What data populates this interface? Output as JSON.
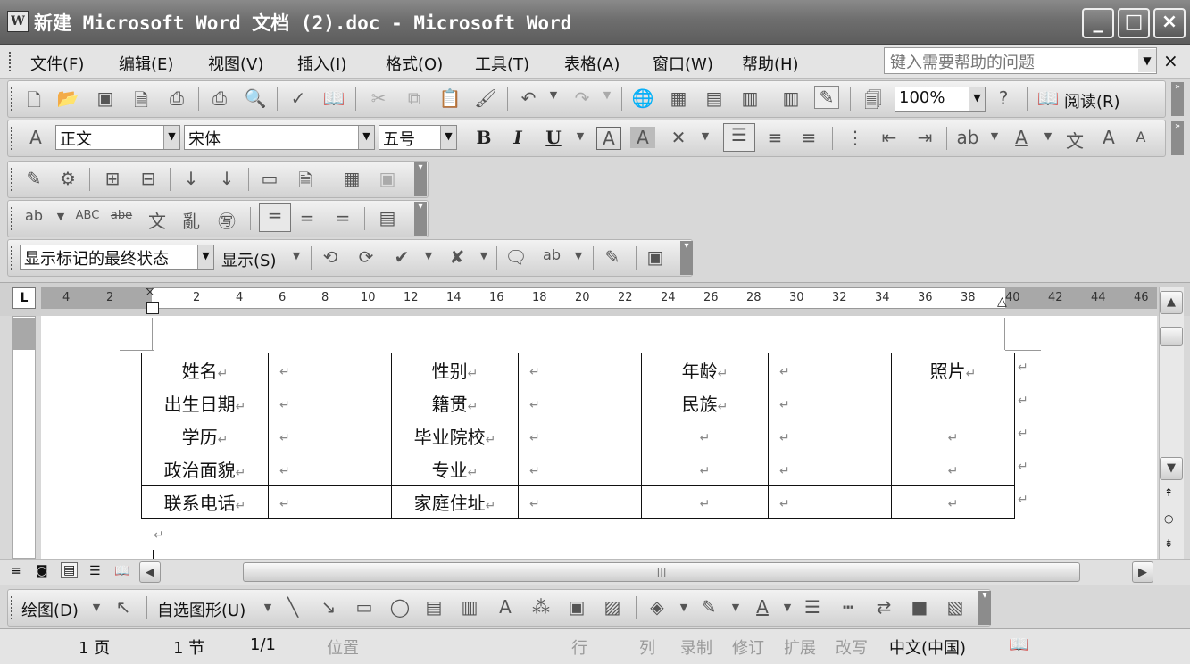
{
  "window": {
    "title": "新建 Microsoft Word 文档 (2).doc - Microsoft Word",
    "app_icon": "W",
    "minimize": "_",
    "maximize": "□",
    "close": "×"
  },
  "menubar": {
    "items": [
      "文件(F)",
      "编辑(E)",
      "视图(V)",
      "插入(I)",
      "格式(O)",
      "工具(T)",
      "表格(A)",
      "窗口(W)",
      "帮助(H)"
    ],
    "help_placeholder": "键入需要帮助的问题",
    "doc_close": "×"
  },
  "standard_toolbar": {
    "zoom": "100%",
    "reading_label": "阅读(R)"
  },
  "formatting_toolbar": {
    "style": "正文",
    "font": "宋体",
    "size": "五号",
    "bold": "B",
    "italic": "I",
    "underline": "U"
  },
  "reviewing_toolbar": {
    "display_state": "显示标记的最终状态",
    "show_label": "显示(S)"
  },
  "ruler": {
    "tab_selector": "L",
    "numbers": [
      "4",
      "2",
      "2",
      "4",
      "6",
      "8",
      "10",
      "12",
      "14",
      "16",
      "18",
      "20",
      "22",
      "24",
      "26",
      "28",
      "30",
      "32",
      "34",
      "36",
      "38",
      "40",
      "42",
      "44",
      "46"
    ]
  },
  "table": {
    "rows": [
      [
        "姓名",
        "",
        "性别",
        "",
        "年龄",
        "",
        "照片"
      ],
      [
        "出生日期",
        "",
        "籍贯",
        "",
        "民族",
        ""
      ],
      [
        "学历",
        "",
        "毕业院校",
        "",
        "",
        "",
        ""
      ],
      [
        "政治面貌",
        "",
        "专业",
        "",
        "",
        "",
        ""
      ],
      [
        "联系电话",
        "",
        "家庭住址",
        "",
        "",
        "",
        ""
      ]
    ],
    "para_mark": "↵"
  },
  "drawing_toolbar": {
    "draw_label": "绘图(D)",
    "autoshape_label": "自选图形(U)"
  },
  "statusbar": {
    "page": "1 页",
    "section": "1 节",
    "pages": "1/1",
    "position": "位置",
    "line": "行",
    "column": "列",
    "record": "录制",
    "revise": "修订",
    "extend": "扩展",
    "overwrite": "改写",
    "language": "中文(中国)"
  }
}
